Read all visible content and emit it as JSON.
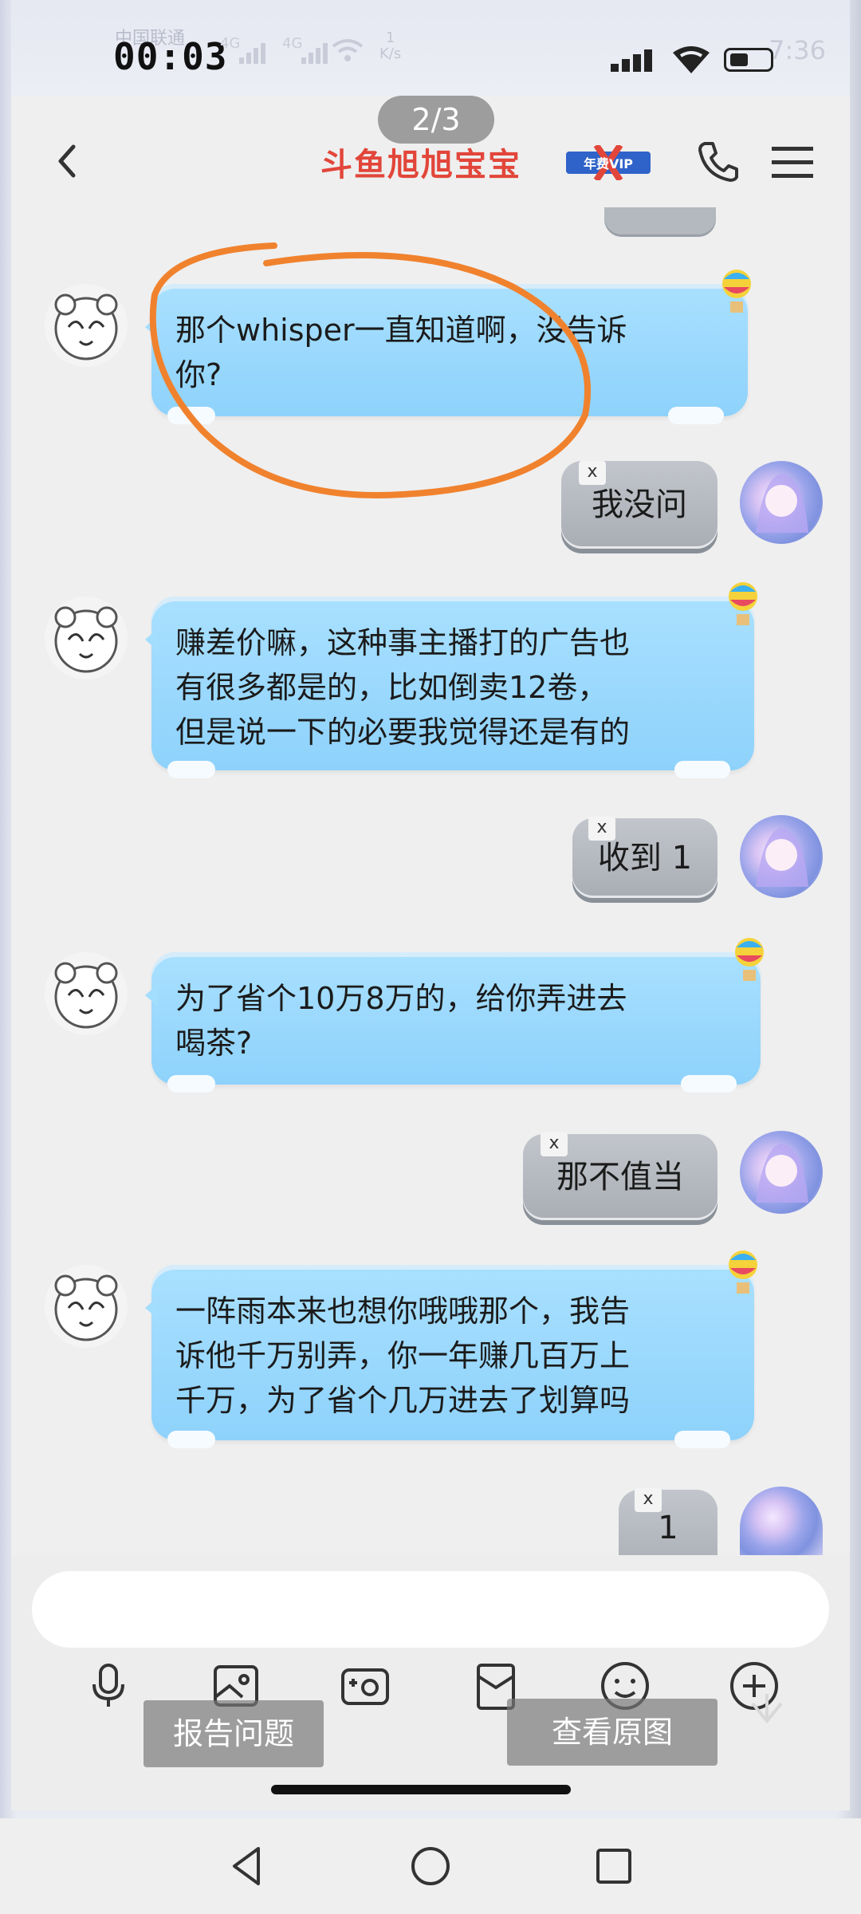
{
  "status": {
    "carrier": "中国联通",
    "recording_time": "00:03",
    "net_speed_value": "1",
    "net_speed_unit": "K/s",
    "signal_label_1": "4G",
    "signal_label_2": "4G",
    "clock": "7:36",
    "battery_level_pct": 35
  },
  "viewer": {
    "page_indicator": "2/3"
  },
  "header": {
    "title": "斗鱼旭旭宝宝",
    "vip_badge_text": "年费VIP"
  },
  "messages": {
    "m1": {
      "lines": [
        "那个whisper一直知道啊，没告诉",
        "你?"
      ]
    },
    "m2": {
      "text": "我没问",
      "tag": "x"
    },
    "m3": {
      "lines": [
        "赚差价嘛，这种事主播打的广告也",
        "有很多都是的，比如倒卖12卷，",
        "但是说一下的必要我觉得还是有的"
      ]
    },
    "m4": {
      "text": "收到 1",
      "tag": "x"
    },
    "m5": {
      "lines": [
        "为了省个10万8万的，给你弄进去",
        "喝茶?"
      ]
    },
    "m6": {
      "text": "那不值当",
      "tag": "x"
    },
    "m7": {
      "lines": [
        "一阵雨本来也想你哦哦那个，我告",
        "诉他千万别弄，你一年赚几百万上",
        "千万，为了省个几万进去了划算吗"
      ]
    },
    "m8": {
      "text": "1",
      "tag": "x"
    }
  },
  "input": {
    "placeholder": ""
  },
  "overlay": {
    "report_label": "报告问题",
    "view_original_label": "查看原图"
  },
  "colors": {
    "title_red": "#e2463a",
    "bubble_in": "#9ad8fd",
    "bubble_out": "#b4b8bf",
    "annotation_orange": "#f0822e"
  }
}
